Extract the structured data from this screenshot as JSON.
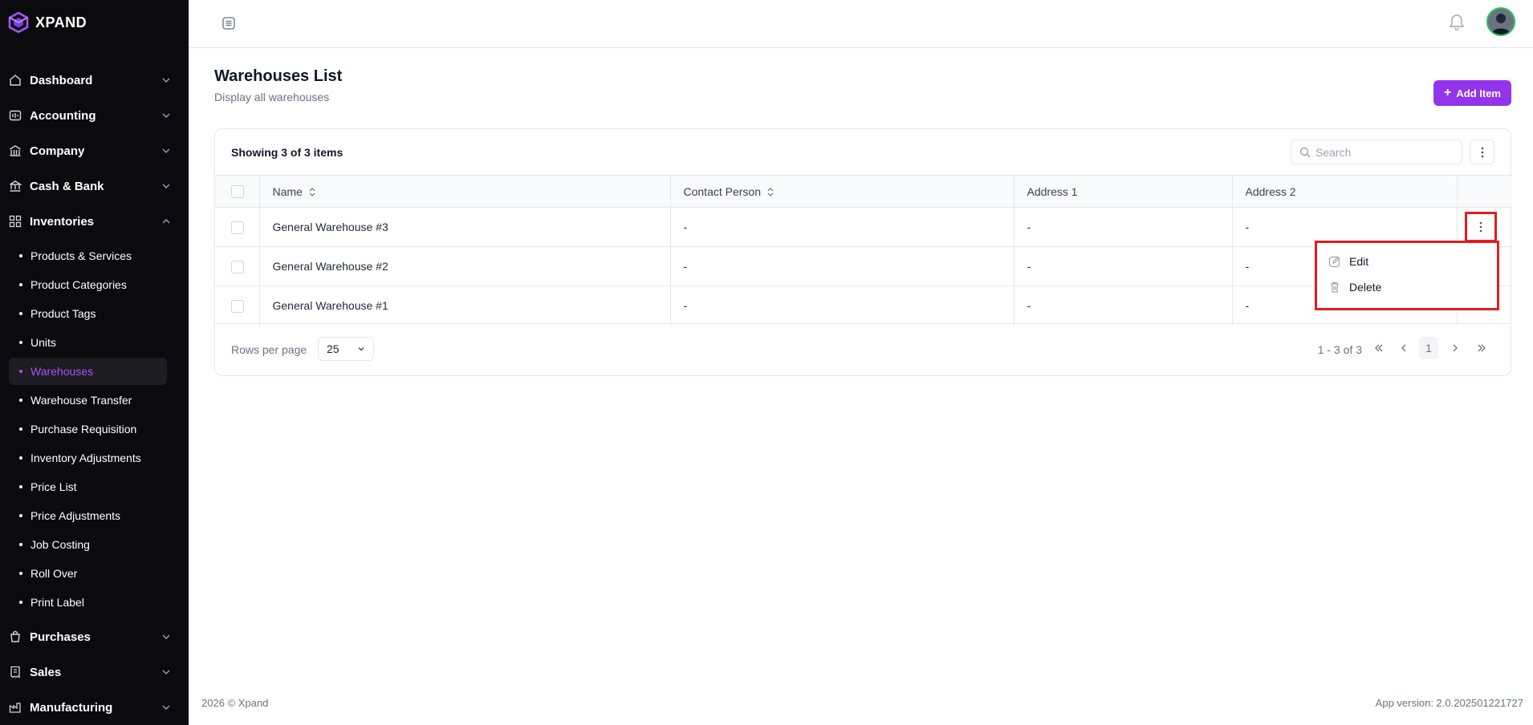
{
  "brand": {
    "name": "XPAND"
  },
  "sidebar": {
    "groups_top": [
      {
        "label": "Dashboard",
        "icon": "home-icon",
        "expanded": false
      },
      {
        "label": "Accounting",
        "icon": "accounting-icon",
        "expanded": false
      },
      {
        "label": "Company",
        "icon": "building-icon",
        "expanded": false
      },
      {
        "label": "Cash & Bank",
        "icon": "bank-icon",
        "expanded": false
      },
      {
        "label": "Inventories",
        "icon": "grid-icon",
        "expanded": true
      }
    ],
    "inventory_items": [
      "Products & Services",
      "Product Categories",
      "Product Tags",
      "Units",
      "Warehouses",
      "Warehouse Transfer",
      "Purchase Requisition",
      "Inventory Adjustments",
      "Price List",
      "Price Adjustments",
      "Job Costing",
      "Roll Over",
      "Print Label"
    ],
    "active_item": "Warehouses",
    "groups_bottom": [
      {
        "label": "Purchases",
        "icon": "bag-icon"
      },
      {
        "label": "Sales",
        "icon": "receipt-icon"
      },
      {
        "label": "Manufacturing",
        "icon": "factory-icon"
      }
    ]
  },
  "page": {
    "title": "Warehouses List",
    "subtitle": "Display all warehouses",
    "add_button": "Add Item"
  },
  "table": {
    "showing": "Showing 3 of 3 items",
    "search_placeholder": "Search",
    "columns": [
      "Name",
      "Contact Person",
      "Address 1",
      "Address 2"
    ],
    "rows": [
      {
        "name": "General Warehouse #3",
        "contact": "-",
        "address1": "-",
        "address2": "-"
      },
      {
        "name": "General Warehouse #2",
        "contact": "-",
        "address1": "-",
        "address2": "-"
      },
      {
        "name": "General Warehouse #1",
        "contact": "-",
        "address1": "-",
        "address2": "-"
      }
    ],
    "rows_per_page_label": "Rows per page",
    "rows_per_page_value": "25",
    "range": "1 - 3 of 3",
    "current_page": "1"
  },
  "row_menu": {
    "edit": "Edit",
    "delete": "Delete"
  },
  "footer": {
    "copyright": "2026 ©  Xpand",
    "version": "App version:  2.0.202501221727"
  },
  "colors": {
    "accent": "#9333ea",
    "highlight_box": "#e11d1d",
    "sidebar_bg": "#0b0b0f"
  }
}
